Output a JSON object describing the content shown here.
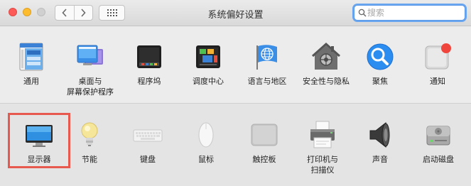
{
  "window": {
    "title": "系统偏好设置",
    "search": {
      "value": "",
      "placeholder": "搜索"
    }
  },
  "personal_panes": [
    {
      "label": "通用",
      "icon": "general-icon"
    },
    {
      "label": "桌面与\n屏幕保护程序",
      "icon": "desktop-screensaver-icon"
    },
    {
      "label": "程序坞",
      "icon": "dock-icon"
    },
    {
      "label": "调度中心",
      "icon": "mission-control-icon"
    },
    {
      "label": "语言与地区",
      "icon": "language-region-icon"
    },
    {
      "label": "安全性与隐私",
      "icon": "security-privacy-icon"
    },
    {
      "label": "聚焦",
      "icon": "spotlight-icon"
    },
    {
      "label": "通知",
      "icon": "notifications-icon"
    }
  ],
  "hardware_panes": [
    {
      "label": "显示器",
      "icon": "displays-icon"
    },
    {
      "label": "节能",
      "icon": "energy-saver-icon"
    },
    {
      "label": "键盘",
      "icon": "keyboard-icon"
    },
    {
      "label": "鼠标",
      "icon": "mouse-icon"
    },
    {
      "label": "触控板",
      "icon": "trackpad-icon"
    },
    {
      "label": "打印机与\n扫描仪",
      "icon": "printers-scanners-icon"
    },
    {
      "label": "声音",
      "icon": "sound-icon"
    },
    {
      "label": "启动磁盘",
      "icon": "startup-disk-icon"
    }
  ],
  "highlighted_pane": "显示器",
  "colors": {
    "highlight": "#e7594f",
    "search_focus": "#5b9ae8"
  }
}
